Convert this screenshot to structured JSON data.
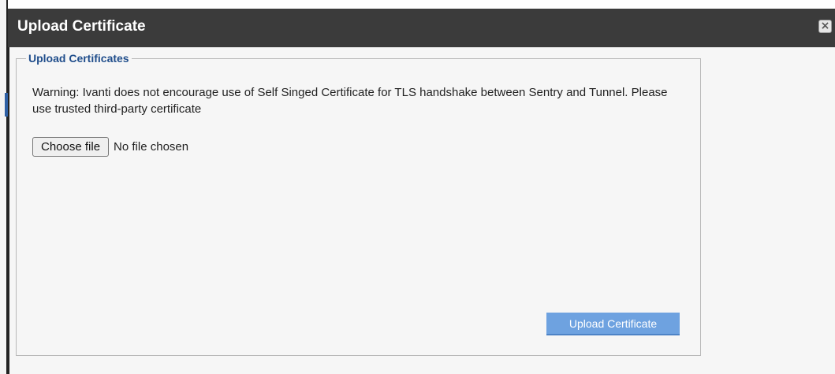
{
  "dialog": {
    "title": "Upload Certificate",
    "close_icon": "close-icon"
  },
  "section": {
    "legend": "Upload Certificates",
    "warning": "Warning: Ivanti does not encourage use of Self Singed Certificate for TLS handshake between Sentry and Tunnel. Please use trusted third-party certificate"
  },
  "file_input": {
    "button_label": "Choose file",
    "status": "No file chosen"
  },
  "actions": {
    "upload_label": "Upload Certificate"
  },
  "colors": {
    "titlebar": "#3b3b3b",
    "legend": "#1f4d8b",
    "upload_button": "#6ea2e0"
  }
}
